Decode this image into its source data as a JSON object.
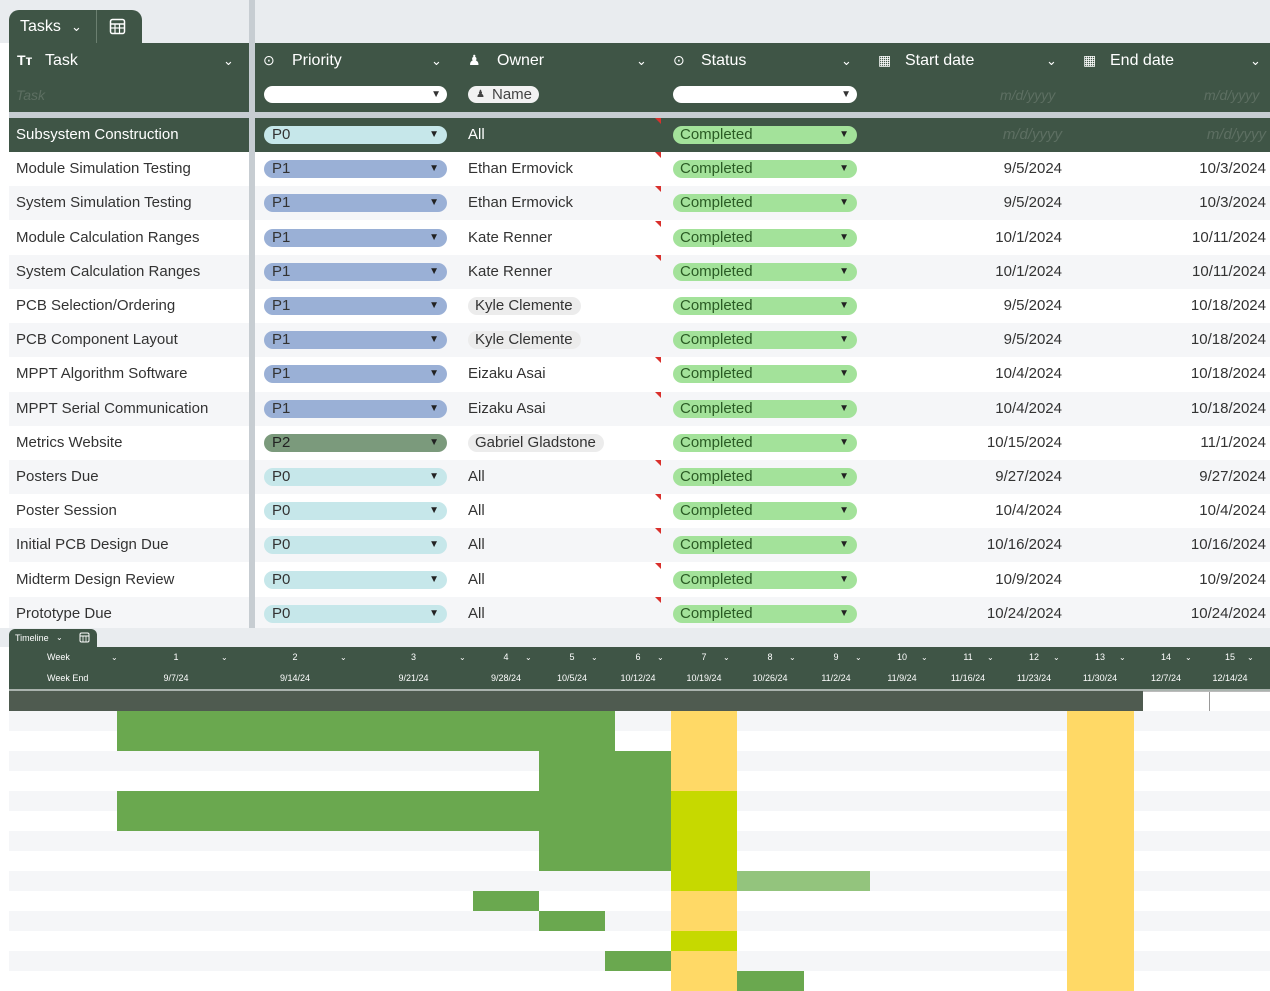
{
  "tasks_tab": {
    "label": "Tasks",
    "chevron_icon": "chevron-down-icon",
    "view_icon": "table-view-icon"
  },
  "columns": [
    {
      "key": "task",
      "label": "Task",
      "icon": "text-type-icon"
    },
    {
      "key": "priority",
      "label": "Priority",
      "icon": "dropdown-pill-icon"
    },
    {
      "key": "owner",
      "label": "Owner",
      "icon": "person-icon"
    },
    {
      "key": "status",
      "label": "Status",
      "icon": "dropdown-pill-icon"
    },
    {
      "key": "start",
      "label": "Start date",
      "icon": "calendar-icon"
    },
    {
      "key": "end",
      "label": "End date",
      "icon": "calendar-icon"
    }
  ],
  "filters": {
    "task_placeholder": "Task",
    "owner_chip": "Name",
    "date_placeholder": "m/d/yyyy"
  },
  "rows": [
    {
      "task": "Subsystem Construction",
      "priority": "P0",
      "owner": "All",
      "owner_chip": false,
      "status": "Completed",
      "start": "m/d/yyyy",
      "end": "m/d/yyyy",
      "flag": true,
      "parent": true
    },
    {
      "task": "Module Simulation Testing",
      "priority": "P1",
      "owner": "Ethan Ermovick",
      "owner_chip": false,
      "status": "Completed",
      "start": "9/5/2024",
      "end": "10/3/2024",
      "flag": true
    },
    {
      "task": "System Simulation Testing",
      "priority": "P1",
      "owner": "Ethan Ermovick",
      "owner_chip": false,
      "status": "Completed",
      "start": "9/5/2024",
      "end": "10/3/2024",
      "flag": true
    },
    {
      "task": "Module Calculation Ranges",
      "priority": "P1",
      "owner": "Kate Renner",
      "owner_chip": false,
      "status": "Completed",
      "start": "10/1/2024",
      "end": "10/11/2024",
      "flag": true
    },
    {
      "task": "System Calculation Ranges",
      "priority": "P1",
      "owner": "Kate Renner",
      "owner_chip": false,
      "status": "Completed",
      "start": "10/1/2024",
      "end": "10/11/2024",
      "flag": true
    },
    {
      "task": "PCB Selection/Ordering",
      "priority": "P1",
      "owner": "Kyle Clemente",
      "owner_chip": true,
      "status": "Completed",
      "start": "9/5/2024",
      "end": "10/18/2024",
      "flag": false
    },
    {
      "task": "PCB Component Layout",
      "priority": "P1",
      "owner": "Kyle Clemente",
      "owner_chip": true,
      "status": "Completed",
      "start": "9/5/2024",
      "end": "10/18/2024",
      "flag": false
    },
    {
      "task": "MPPT Algorithm Software",
      "priority": "P1",
      "owner": "Eizaku Asai",
      "owner_chip": false,
      "status": "Completed",
      "start": "10/4/2024",
      "end": "10/18/2024",
      "flag": true
    },
    {
      "task": "MPPT Serial Communication",
      "priority": "P1",
      "owner": "Eizaku Asai",
      "owner_chip": false,
      "status": "Completed",
      "start": "10/4/2024",
      "end": "10/18/2024",
      "flag": true
    },
    {
      "task": "Metrics Website",
      "priority": "P2",
      "owner": "Gabriel Gladstone",
      "owner_chip": true,
      "status": "Completed",
      "start": "10/15/2024",
      "end": "11/1/2024",
      "flag": false
    },
    {
      "task": "Posters Due",
      "priority": "P0",
      "owner": "All",
      "owner_chip": false,
      "status": "Completed",
      "start": "9/27/2024",
      "end": "9/27/2024",
      "flag": true
    },
    {
      "task": "Poster Session",
      "priority": "P0",
      "owner": "All",
      "owner_chip": false,
      "status": "Completed",
      "start": "10/4/2024",
      "end": "10/4/2024",
      "flag": true
    },
    {
      "task": "Initial PCB Design Due",
      "priority": "P0",
      "owner": "All",
      "owner_chip": false,
      "status": "Completed",
      "start": "10/16/2024",
      "end": "10/16/2024",
      "flag": true
    },
    {
      "task": "Midterm Design Review",
      "priority": "P0",
      "owner": "All",
      "owner_chip": false,
      "status": "Completed",
      "start": "10/9/2024",
      "end": "10/9/2024",
      "flag": true
    },
    {
      "task": "Prototype Due",
      "priority": "P0",
      "owner": "All",
      "owner_chip": false,
      "status": "Completed",
      "start": "10/24/2024",
      "end": "10/24/2024",
      "flag": true
    }
  ],
  "timeline": {
    "tab_label": "Timeline",
    "week_label": "Week",
    "week_end_label": "Week End",
    "weeks": [
      "1",
      "2",
      "3",
      "4",
      "5",
      "6",
      "7",
      "8",
      "9",
      "10",
      "11",
      "12",
      "13",
      "14",
      "15"
    ],
    "week_ends": [
      "9/7/24",
      "9/14/24",
      "9/21/24",
      "9/28/24",
      "10/5/24",
      "10/12/24",
      "10/19/24",
      "10/26/24",
      "11/2/24",
      "11/9/24",
      "11/16/24",
      "11/23/24",
      "11/30/24",
      "12/7/24",
      "12/14/24"
    ]
  },
  "colors": {
    "header_bg": "#3f5546",
    "p0": "#c6e7ea",
    "p1": "#9ab0d6",
    "p2": "#7b9a7c",
    "status_completed": "#a3e29a",
    "gantt_green": "#6aa84f",
    "gantt_light_green": "#93c47d",
    "gantt_yellow": "#ffd966",
    "gantt_lime": "#c6d900"
  }
}
